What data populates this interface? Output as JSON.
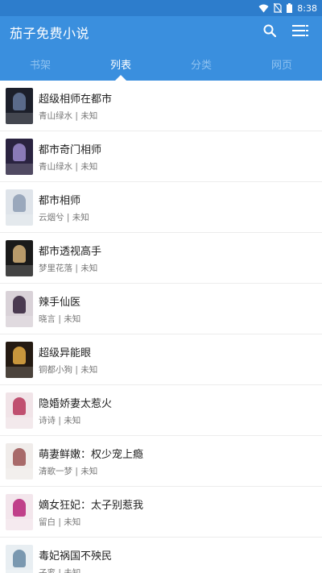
{
  "status_bar": {
    "time": "8:38"
  },
  "app_bar": {
    "title": "茄子免费小说",
    "search_icon": "search-icon",
    "menu_icon": "list-menu-icon"
  },
  "tabs": [
    {
      "label": "书架",
      "active": false
    },
    {
      "label": "列表",
      "active": true
    },
    {
      "label": "分类",
      "active": false
    },
    {
      "label": "网页",
      "active": false
    }
  ],
  "colors": {
    "status_bar": "#2d7dcc",
    "app_bar": "#3a8fde",
    "tab_inactive": "#8fc2f0",
    "tab_active": "#ffffff"
  },
  "books": [
    {
      "title": "超级相师在都市",
      "author": "青山绿水",
      "status": "未知",
      "cover_bg": "#1c1f2a",
      "cover_fig": "#5a6a8a"
    },
    {
      "title": "都市奇门相师",
      "author": "青山绿水",
      "status": "未知",
      "cover_bg": "#2a2340",
      "cover_fig": "#8a7ab8"
    },
    {
      "title": "都市相师",
      "author": "云烟兮",
      "status": "未知",
      "cover_bg": "#dfe4ea",
      "cover_fig": "#9aa8bc"
    },
    {
      "title": "都市透视高手",
      "author": "梦里花落",
      "status": "未知",
      "cover_bg": "#1a1a1a",
      "cover_fig": "#b89a6a"
    },
    {
      "title": "辣手仙医",
      "author": "晓言",
      "status": "未知",
      "cover_bg": "#d9d2d8",
      "cover_fig": "#4a3a50"
    },
    {
      "title": "超级异能眼",
      "author": "铜都小狗",
      "status": "未知",
      "cover_bg": "#241a12",
      "cover_fig": "#c8963c"
    },
    {
      "title": "隐婚娇妻太惹火",
      "author": "诗诗",
      "status": "未知",
      "cover_bg": "#f1e4e8",
      "cover_fig": "#c05070"
    },
    {
      "title": "萌妻鲜嫩：权少宠上瘾",
      "author": "清歌一梦",
      "status": "未知",
      "cover_bg": "#f0ecea",
      "cover_fig": "#a86a6a"
    },
    {
      "title": "嫡女狂妃：太子别惹我",
      "author": "留白",
      "status": "未知",
      "cover_bg": "#f3e6ec",
      "cover_fig": "#c0408a"
    },
    {
      "title": "毒妃祸国不殃民",
      "author": "子鸾",
      "status": "未知",
      "cover_bg": "#e8eef2",
      "cover_fig": "#7a98b0"
    }
  ]
}
